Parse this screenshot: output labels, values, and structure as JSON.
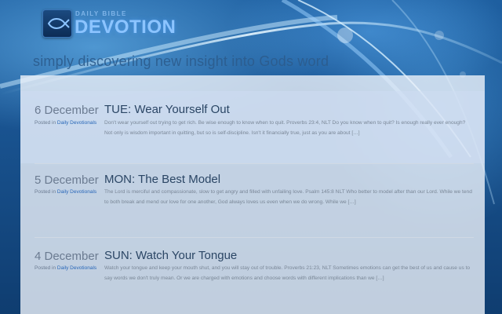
{
  "header": {
    "logo_small": "DAILY BIBLE",
    "logo_big": "DEVOTION",
    "tagline": "simply discovering new insight into Gods word"
  },
  "posts": [
    {
      "date": "6 December",
      "posted_prefix": "Posted in",
      "category": "Daily Devotionals",
      "title": "TUE: Wear Yourself Out",
      "excerpt": "Don't wear yourself out trying to get rich. Be wise enough to know when to quit. Proverbs 23:4, NLT Do you know when to quit? Is enough really ever enough? Not only is wisdom important in quitting, but so is self-discipline. Isn't it financially true, just as you are about […]"
    },
    {
      "date": "5 December",
      "posted_prefix": "Posted in",
      "category": "Daily Devotionals",
      "title": "MON: The Best Model",
      "excerpt": "The Lord is merciful and compassionate, slow to get angry and filled with unfailing love. Psalm 145:8 NLT Who better to model after than our Lord. While we tend to both break and mend our love for one another, God always loves us even when we do wrong. While we […]"
    },
    {
      "date": "4 December",
      "posted_prefix": "Posted in",
      "category": "Daily Devotionals",
      "title": "SUN: Watch Your Tongue",
      "excerpt": "Watch your tongue and keep your mouth shut, and you will stay out of trouble. Proverbs 21:23, NLT Sometimes emotions can get the best of us and cause us to say words we don't truly mean. Or we are charged with emotions and choose words with different implications than we […]"
    }
  ],
  "colors": {
    "background": "#0d3a68",
    "link": "#2a68b8",
    "title": "#2b4665",
    "muted": "#6b7b91"
  },
  "icons": {
    "logo": "fish-icon"
  }
}
